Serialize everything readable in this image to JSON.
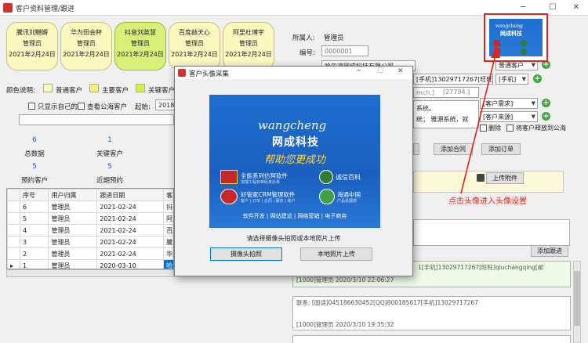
{
  "window": {
    "title": "客户资料管理/跟进",
    "min_glyph": "─",
    "max_glyph": "☐",
    "close_glyph": "✕"
  },
  "cards": [
    {
      "name": "騰讯刘嬲媷",
      "owner": "管理员",
      "date": "2021年2月24日",
      "active": false
    },
    {
      "name": "华为田会秤",
      "owner": "管理员",
      "date": "2021年2月24日",
      "active": false
    },
    {
      "name": "抖音刘英慧",
      "owner": "管理员",
      "date": "2021年2月24日",
      "active": true
    },
    {
      "name": "百度赫天心",
      "owner": "管理员",
      "date": "2021年2月24日",
      "active": false
    },
    {
      "name": "阿里杜博宇",
      "owner": "管理员",
      "date": "2021年2月24日",
      "active": false
    }
  ],
  "legend": {
    "label": "颜色说明:",
    "normal": "普通客户",
    "main": "主要客户",
    "key": "关键客户"
  },
  "filters": {
    "only_mine": "只显示自己的",
    "view_public": "查看公海客户",
    "start_label": "起始:",
    "start_value": "2018-0"
  },
  "stats": [
    {
      "value": "6",
      "label": "总数据"
    },
    {
      "value": "1",
      "label": "关键客户"
    },
    {
      "value": "5",
      "label": "预约客户"
    },
    {
      "value": "5",
      "label": "近期预约"
    }
  ],
  "table": {
    "headers": [
      "序号",
      "用户归属",
      "跟进日期",
      "客户信息"
    ],
    "rows": [
      [
        "6",
        "管理员",
        "2021-02-24",
        "抖音刘英慧营销"
      ],
      [
        "5",
        "管理员",
        "2021-02-24",
        "阿里杜博宇营销"
      ],
      [
        "4",
        "管理员",
        "2021-02-24",
        "百度赫天心大区"
      ],
      [
        "3",
        "管理员",
        "2021-02-24",
        "騰讯刘嬲媷市场"
      ],
      [
        "2",
        "管理员",
        "2021-02-24",
        "华为田会秤市场"
      ],
      [
        "1",
        "管理员",
        "2020-03-10",
        "哈尔滨网成科技"
      ]
    ],
    "current_marker": "▸"
  },
  "detail": {
    "owner_label": "所属人:",
    "owner_value": "管理员",
    "id_label": "编号:",
    "id_value": "0000001",
    "company_value": "哈尔滨网成科技有限公司",
    "contact_value": "[手机]13029717267[旺旺]",
    "mobile_select": "[手机]",
    "type_select": "普通客户",
    "qq_fragment": "mch.]",
    "qq_value": "[27794.]",
    "note_line1": "系统。",
    "note_line2": "统；  雅源系统，就",
    "need_select": "[客户需求]",
    "source_select": "[客户来源]",
    "delete_label": "删除",
    "release_label": "将客户释放到公海",
    "add_contract": "添加合同",
    "add_order": "添加订单",
    "upload": "上传附件",
    "add_follow": "添加跟进"
  },
  "logs": [
    {
      "text": "1[手机]13029717267[旺旺]qiuchangqing[邮"
    },
    {
      "text": "[1000]管理员     2020/3/10 22:06:27"
    },
    {
      "text": "联系: [固话]045186630452[QQ]800185617[手机]13029717267"
    },
    {
      "text": "[1000]管理员     2020/3/10 19:35:32"
    }
  ],
  "annotation": {
    "text": "点击头像进入头像设置",
    "color": "#e0261c"
  },
  "dialog": {
    "title": "客户头像采集",
    "logo": {
      "brand": "wangcheng",
      "cn_name": "网成科技",
      "slogan": "帮助您更成功",
      "p1": "全能系列仿冥软件",
      "p1_sub": "加理工程标等经来办事",
      "p2": "诚信百科",
      "p3": "好管家CRM管理软件",
      "p3_sub": "客户 | 订单 | 合同 | 服务 | 账户",
      "p4": "海通中国",
      "p4_sub": "产品进展搜",
      "footer": "软件开发 | 网站建设 | 网络营销 | 电子商务"
    },
    "hint": "请选择摄像头拍照或本地照片上传",
    "camera_btn": "摄像头拍照",
    "local_btn": "本地照片上传"
  }
}
